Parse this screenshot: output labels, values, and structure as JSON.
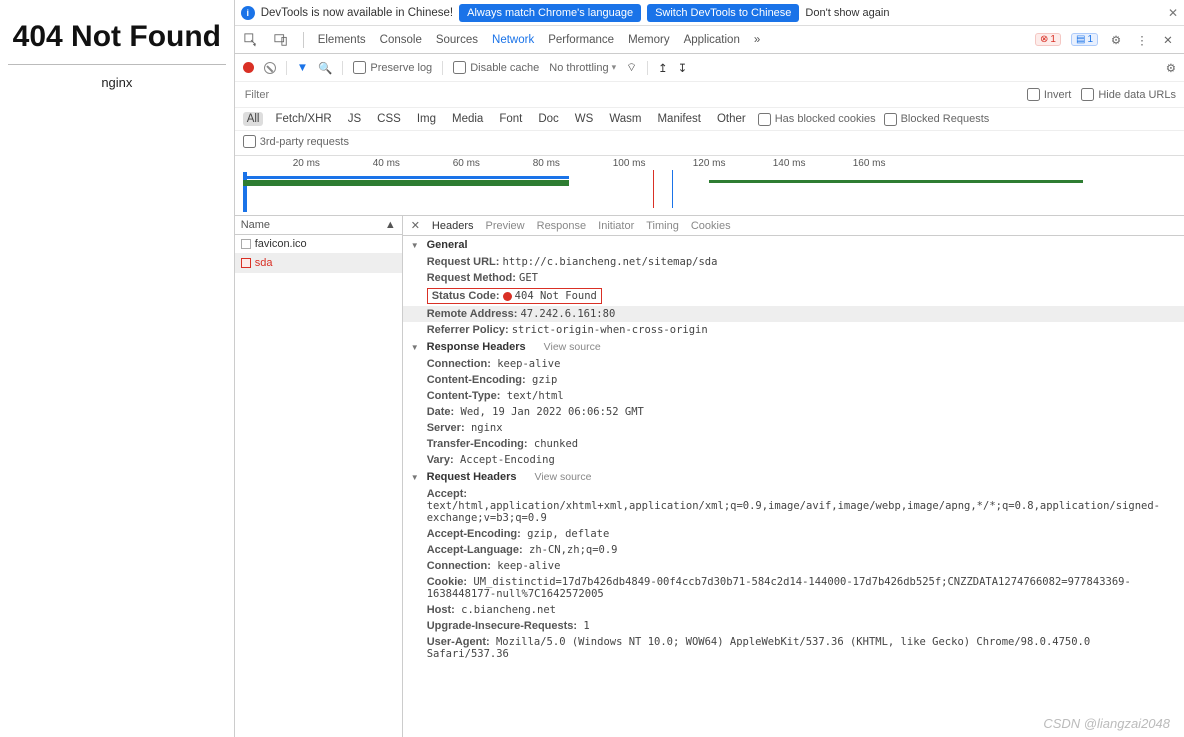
{
  "page404": {
    "title": "404 Not Found",
    "server": "nginx"
  },
  "infobar": {
    "text": "DevTools is now available in Chinese!",
    "btn1": "Always match Chrome's language",
    "btn2": "Switch DevTools to Chinese",
    "dismiss": "Don't show again"
  },
  "tabs": {
    "elements": "Elements",
    "console": "Console",
    "sources": "Sources",
    "network": "Network",
    "performance": "Performance",
    "memory": "Memory",
    "application": "Application",
    "more": "»"
  },
  "errors": "1",
  "messages": "1",
  "netbar": {
    "preserve": "Preserve log",
    "disable": "Disable cache",
    "throttling": "No throttling"
  },
  "filter": {
    "placeholder": "Filter",
    "invert": "Invert",
    "hide": "Hide data URLs"
  },
  "types": {
    "all": "All",
    "fetch": "Fetch/XHR",
    "js": "JS",
    "css": "CSS",
    "img": "Img",
    "media": "Media",
    "font": "Font",
    "doc": "Doc",
    "ws": "WS",
    "wasm": "Wasm",
    "manifest": "Manifest",
    "other": "Other",
    "blocked_cookies": "Has blocked cookies",
    "blocked_req": "Blocked Requests",
    "third": "3rd-party requests"
  },
  "timeline_ticks": [
    "20 ms",
    "40 ms",
    "60 ms",
    "80 ms",
    "100 ms",
    "120 ms",
    "140 ms",
    "160 ms"
  ],
  "reqlist": {
    "name": "Name",
    "items": [
      "favicon.ico",
      "sda"
    ]
  },
  "detail_tabs": {
    "headers": "Headers",
    "preview": "Preview",
    "response": "Response",
    "initiator": "Initiator",
    "timing": "Timing",
    "cookies": "Cookies"
  },
  "general_label": "General",
  "view_source": "View source",
  "general": {
    "url_k": "Request URL:",
    "url_v": "http://c.biancheng.net/sitemap/sda",
    "method_k": "Request Method:",
    "method_v": "GET",
    "status_k": "Status Code:",
    "status_v": "404 Not Found",
    "addr_k": "Remote Address:",
    "addr_v": "47.242.6.161:80",
    "ref_k": "Referrer Policy:",
    "ref_v": "strict-origin-when-cross-origin"
  },
  "resp_label": "Response Headers",
  "resp": [
    {
      "k": "Connection:",
      "v": "keep-alive"
    },
    {
      "k": "Content-Encoding:",
      "v": "gzip"
    },
    {
      "k": "Content-Type:",
      "v": "text/html"
    },
    {
      "k": "Date:",
      "v": "Wed, 19 Jan 2022 06:06:52 GMT"
    },
    {
      "k": "Server:",
      "v": "nginx"
    },
    {
      "k": "Transfer-Encoding:",
      "v": "chunked"
    },
    {
      "k": "Vary:",
      "v": "Accept-Encoding"
    }
  ],
  "req_label": "Request Headers",
  "req": [
    {
      "k": "Accept:",
      "v": "text/html,application/xhtml+xml,application/xml;q=0.9,image/avif,image/webp,image/apng,*/*;q=0.8,application/signed-exchange;v=b3;q=0.9"
    },
    {
      "k": "Accept-Encoding:",
      "v": "gzip, deflate"
    },
    {
      "k": "Accept-Language:",
      "v": "zh-CN,zh;q=0.9"
    },
    {
      "k": "Connection:",
      "v": "keep-alive"
    },
    {
      "k": "Cookie:",
      "v": "UM_distinctid=17d7b426db4849-00f4ccb7d30b71-584c2d14-144000-17d7b426db525f;CNZZDATA1274766082=977843369-1638448177-null%7C1642572005"
    },
    {
      "k": "Host:",
      "v": "c.biancheng.net"
    },
    {
      "k": "Upgrade-Insecure-Requests:",
      "v": "1"
    },
    {
      "k": "User-Agent:",
      "v": "Mozilla/5.0 (Windows NT 10.0; WOW64) AppleWebKit/537.36 (KHTML, like Gecko) Chrome/98.0.4750.0 Safari/537.36"
    }
  ],
  "watermark": "CSDN @liangzai2048"
}
